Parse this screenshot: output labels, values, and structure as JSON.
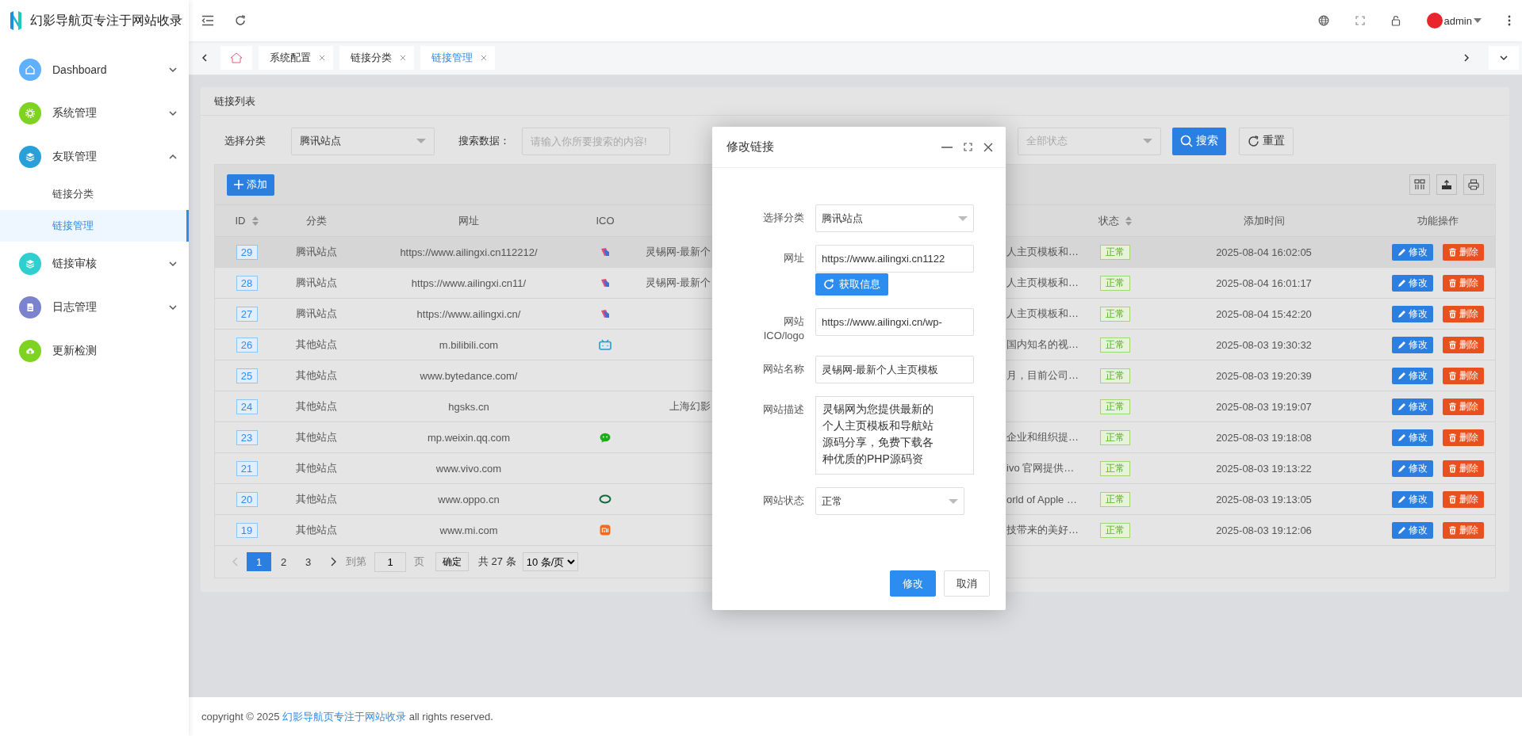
{
  "brand": {
    "title": "幻影导航页专注于网站收录"
  },
  "sidebar": {
    "items": [
      {
        "label": "Dashboard",
        "color": "#5fb0ff",
        "kind": "group",
        "expanded": false
      },
      {
        "label": "系统管理",
        "color": "#7ed321",
        "kind": "group",
        "expanded": false
      },
      {
        "label": "友联管理",
        "color": "#2b9fd8",
        "kind": "group",
        "expanded": true,
        "children": [
          {
            "label": "链接分类",
            "selected": false
          },
          {
            "label": "链接管理",
            "selected": true
          }
        ]
      },
      {
        "label": "链接审核",
        "color": "#2ecfcf",
        "kind": "group",
        "expanded": false
      },
      {
        "label": "日志管理",
        "color": "#7b83cf",
        "kind": "group",
        "expanded": false
      },
      {
        "label": "更新检测",
        "color": "#7ed321",
        "kind": "link"
      }
    ]
  },
  "header": {
    "user": "admin"
  },
  "tabs": [
    {
      "kind": "home",
      "selected": false
    },
    {
      "kind": "page",
      "label": "系统配置",
      "selected": false
    },
    {
      "kind": "page",
      "label": "链接分类",
      "selected": false
    },
    {
      "kind": "page",
      "label": "链接管理",
      "selected": true
    }
  ],
  "panel": {
    "title": "链接列表",
    "filters": [
      {
        "kind": "select",
        "label": "选择分类",
        "value": "腾讯站点"
      },
      {
        "kind": "input",
        "label": "搜索数据：",
        "placeholder": "请输入你所要搜索的内容!"
      },
      {
        "kind": "select",
        "placeholder": "全部状态"
      }
    ],
    "search_button": "搜索",
    "reset_button": "重置",
    "add_button": "添加"
  },
  "table": {
    "columns": [
      {
        "label": "ID",
        "sortable": true
      },
      {
        "label": "分类",
        "sortable": false
      },
      {
        "label": "网址",
        "sortable": false
      },
      {
        "label": "ICO",
        "sortable": false
      },
      {
        "label": "状态",
        "sortable": true
      },
      {
        "label": "添加时间",
        "sortable": false
      },
      {
        "label": "功能操作",
        "sortable": false
      }
    ],
    "rows": [
      {
        "id": "29",
        "category": "腾讯站点",
        "url": "https://www.ailingxi.cn112212/",
        "kind": "ribbon",
        "column_5": "灵锡网-最新个",
        "column_6": "人主页模板和…",
        "status": "正常",
        "added": "2025-08-04 16:02:05",
        "actions": [
          "修改",
          "删除"
        ],
        "selected": true
      },
      {
        "id": "28",
        "category": "腾讯站点",
        "url": "https://www.ailingxi.cn11/",
        "kind": "ribbon",
        "column_5": "灵锡网-最新个",
        "column_6": "人主页模板和…",
        "status": "正常",
        "added": "2025-08-04 16:01:17",
        "actions": [
          "修改",
          "删除"
        ],
        "selected": false
      },
      {
        "id": "27",
        "category": "腾讯站点",
        "url": "https://www.ailingxi.cn/",
        "kind": "ribbon",
        "column_6": "人主页模板和…",
        "status": "正常",
        "added": "2025-08-04 15:42:20",
        "actions": [
          "修改",
          "删除"
        ],
        "selected": false
      },
      {
        "id": "26",
        "category": "其他站点",
        "url": "m.bilibili.com",
        "kind": "tv",
        "column_6": "国内知名的视…",
        "status": "正常",
        "added": "2025-08-03 19:30:32",
        "actions": [
          "修改",
          "删除"
        ],
        "selected": false
      },
      {
        "id": "25",
        "category": "其他站点",
        "url": "www.bytedance.com/",
        "kind": "none",
        "column_6": "月，目前公司…",
        "status": "正常",
        "added": "2025-08-03 19:20:39",
        "actions": [
          "修改",
          "删除"
        ],
        "selected": false
      },
      {
        "id": "24",
        "category": "其他站点",
        "url": "hgsks.cn",
        "kind": "none",
        "column_5": "上海幻影",
        "status": "正常",
        "added": "2025-08-03 19:19:07",
        "actions": [
          "修改",
          "删除"
        ],
        "selected": false
      },
      {
        "id": "23",
        "category": "其他站点",
        "url": "mp.weixin.qq.com",
        "kind": "bubble",
        "column_6": "企业和组织提…",
        "status": "正常",
        "added": "2025-08-03 19:18:08",
        "actions": [
          "修改",
          "删除"
        ],
        "selected": false
      },
      {
        "id": "21",
        "category": "其他站点",
        "url": "www.vivo.com",
        "kind": "none",
        "column_6": "ivo 官网提供…",
        "status": "正常",
        "added": "2025-08-03 19:13:22",
        "actions": [
          "修改",
          "删除"
        ],
        "selected": false
      },
      {
        "id": "20",
        "category": "其他站点",
        "url": "www.oppo.cn",
        "kind": "ring",
        "column_6": "orld of Apple …",
        "status": "正常",
        "added": "2025-08-03 19:13:05",
        "actions": [
          "修改",
          "删除"
        ],
        "selected": false
      },
      {
        "id": "19",
        "category": "其他站点",
        "url": "www.mi.com",
        "kind": "square",
        "column_6": "技带来的美好…",
        "status": "正常",
        "added": "2025-08-03 19:12:06",
        "actions": [
          "修改",
          "删除"
        ],
        "selected": false
      }
    ]
  },
  "pagination": {
    "pages": [
      {
        "label": "1",
        "selected": true
      },
      {
        "label": "2",
        "selected": false
      },
      {
        "label": "3",
        "selected": false
      }
    ],
    "goto_label": "到第",
    "goto_value": "1",
    "page_unit": "页",
    "confirm": "确定",
    "total": "共 27 条",
    "page_size": "10 条/页"
  },
  "modal": {
    "title": "修改链接",
    "fields": [
      {
        "kind": "select",
        "label": "选择分类",
        "value": "腾讯站点"
      },
      {
        "kind": "input",
        "label": "网址",
        "value": "https://www.ailingxi.cn1122",
        "action": "获取信息"
      },
      {
        "kind": "input",
        "label": "网站ICO/logo",
        "value": "https://www.ailingxi.cn/wp-"
      },
      {
        "kind": "input",
        "label": "网站名称",
        "value": "灵锡网-最新个人主页模板"
      },
      {
        "kind": "textarea",
        "label": "网站描述",
        "value": "灵锡网为您提供最新的个人主页模板和导航站源码分享，免费下载各种优质的PHP源码资"
      },
      {
        "kind": "select",
        "label": "网站状态",
        "value": "正常"
      }
    ],
    "buttons": [
      {
        "kind": "primary",
        "label": "修改"
      },
      {
        "kind": "default",
        "label": "取消"
      }
    ]
  },
  "footer": {
    "prefix": "copyright © 2025",
    "link": "幻影导航页专注于网站收录",
    "suffix": "all rights reserved."
  }
}
